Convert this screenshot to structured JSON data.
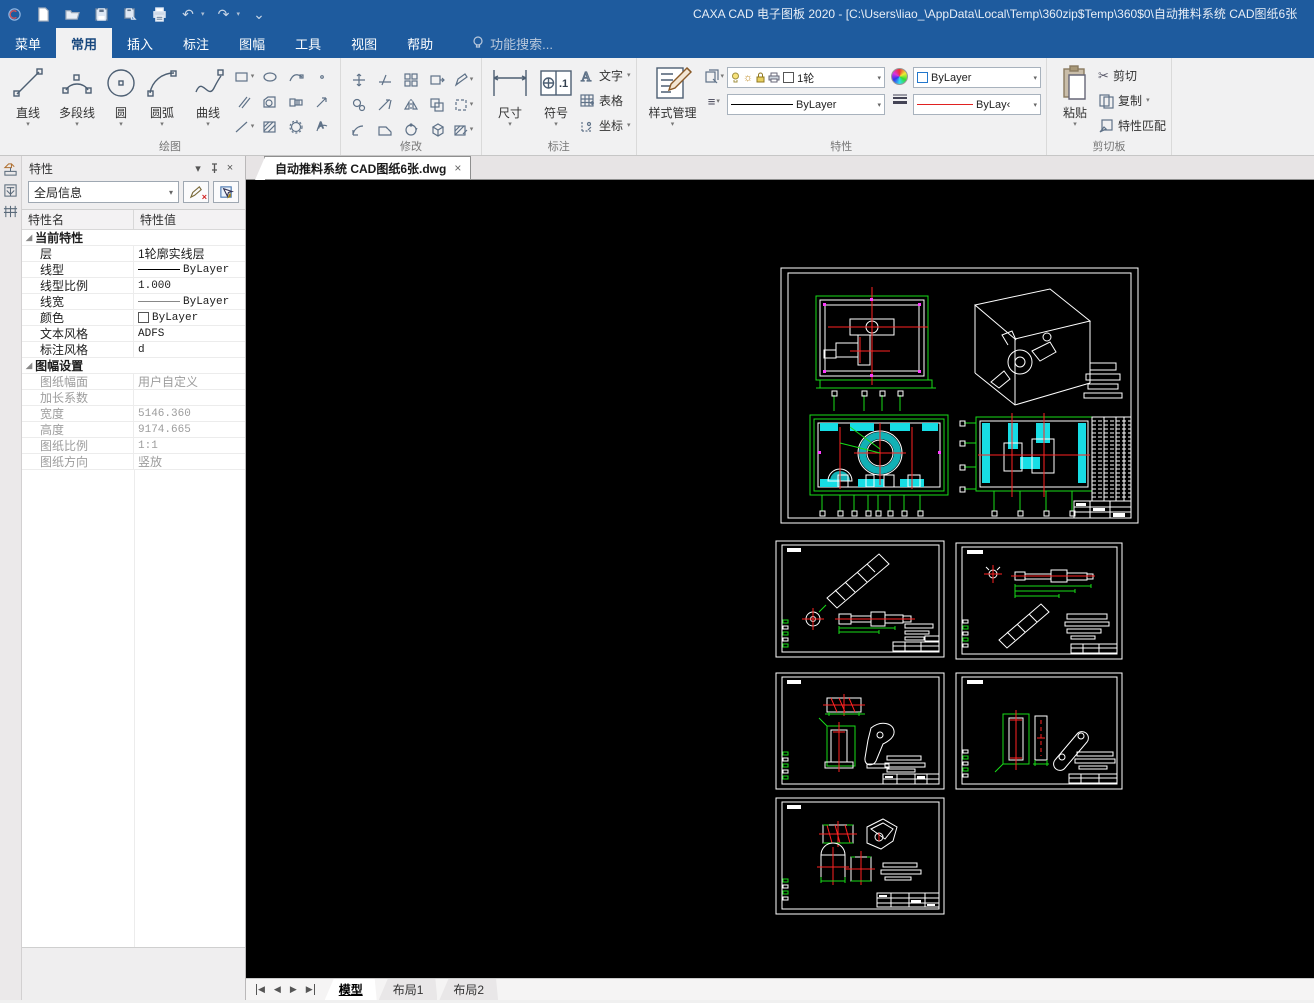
{
  "window": {
    "title": "CAXA CAD 电子图板 2020 - [C:\\Users\\liao_\\AppData\\Local\\Temp\\360zip$Temp\\360$0\\自动推料系统 CAD图纸6张"
  },
  "icons": {
    "dropdown": "▾",
    "close": "×",
    "undo": "↶",
    "redo": "↷",
    "customize": "⌄",
    "sun": "☼",
    "scissors": "✂",
    "menu_lines": "≡",
    "nav_first": "◀",
    "nav_prev": "◀",
    "nav_next": "▶",
    "nav_last": "▶",
    "expanded_triangle": "◢"
  },
  "menu_tabs": {
    "items": [
      "菜单",
      "常用",
      "插入",
      "标注",
      "图幅",
      "工具",
      "视图",
      "帮助"
    ],
    "search": "功能搜索..."
  },
  "ribbon": {
    "draw": {
      "label": "绘图",
      "buttons": [
        {
          "label": "直线"
        },
        {
          "label": "多段线"
        },
        {
          "label": "圆"
        },
        {
          "label": "圆弧"
        },
        {
          "label": "曲线"
        }
      ]
    },
    "modify": {
      "label": "修改"
    },
    "annotate": {
      "label": "标注",
      "dim": "尺寸",
      "symbol": "符号",
      "text": "文字",
      "table": "表格",
      "coord": "坐标",
      "symbol_badge": ".1",
      "text_glyph": "A"
    },
    "props": {
      "label": "特性",
      "style_mgr": "样式管理",
      "layer_value": "1轮",
      "color_value": "ByLayer",
      "linetype_value": "ByLayer",
      "lineweight_value": "ByLay‹"
    },
    "clipboard": {
      "label": "剪切板",
      "paste": "粘贴",
      "cut": "剪切",
      "copy": "复制",
      "match": "特性匹配"
    }
  },
  "panel": {
    "title": "特性",
    "scope": "全局信息",
    "columns": [
      "特性名",
      "特性值"
    ],
    "rows": [
      {
        "name": "当前特性",
        "value": ""
      },
      {
        "name": "层",
        "value": "1轮廓实线层"
      },
      {
        "name": "线型",
        "value": "ByLayer"
      },
      {
        "name": "线型比例",
        "value": "1.000"
      },
      {
        "name": "线宽",
        "value": "ByLayer"
      },
      {
        "name": "颜色",
        "value": "ByLayer"
      },
      {
        "name": "文本风格",
        "value": "ADFS"
      },
      {
        "name": "标注风格",
        "value": "d"
      },
      {
        "name": "图幅设置",
        "value": ""
      },
      {
        "name": "图纸幅面",
        "value": "用户自定义"
      },
      {
        "name": "加长系数",
        "value": ""
      },
      {
        "name": "宽度",
        "value": "5146.360"
      },
      {
        "name": "高度",
        "value": "9174.665"
      },
      {
        "name": "图纸比例",
        "value": "1:1"
      },
      {
        "name": "图纸方向",
        "value": "竖放"
      }
    ]
  },
  "doc_tab": {
    "label": "自动推料系统 CAD图纸6张.dwg"
  },
  "sheet_tabs": [
    "模型",
    "布局1",
    "布局2"
  ],
  "colors": {
    "titlebar": "#1e5b9e",
    "canvas": "#000000",
    "cad_white": "#ffffff",
    "cad_green": "#17dd17",
    "cad_red": "#ff2222",
    "cad_cyan": "#17dde4",
    "cad_magenta": "#ff3cff"
  }
}
